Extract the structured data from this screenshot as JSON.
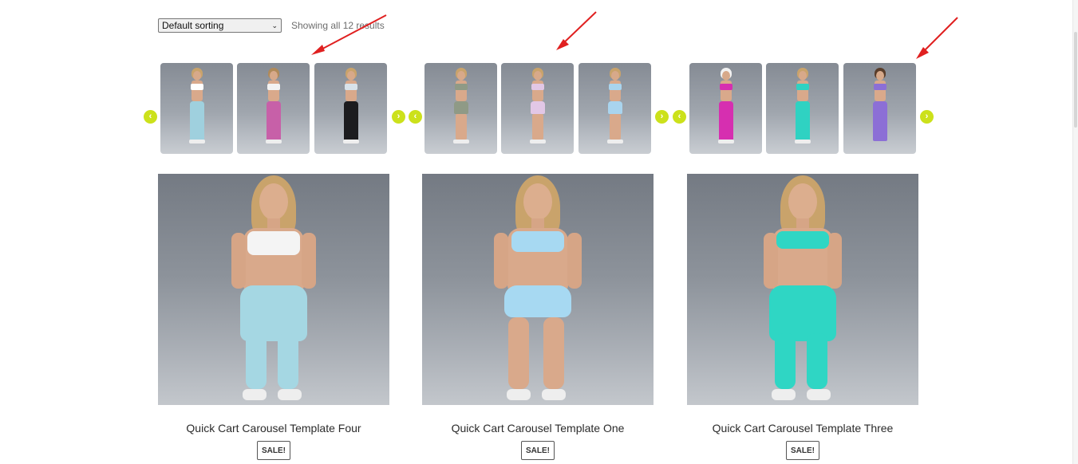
{
  "toolbar": {
    "sort_label": "Default sorting",
    "sort_options": [
      "Default sorting"
    ],
    "result_count": "Showing all 12 results"
  },
  "carousels": [
    {
      "thumbnails": [
        {
          "icon": "product-photo-light-blue-leggings"
        },
        {
          "icon": "product-photo-pink-leggings"
        },
        {
          "icon": "product-photo-black-leggings"
        }
      ],
      "prev_icon": "chevron-left-icon",
      "next_icon": "chevron-right-icon"
    },
    {
      "thumbnails": [
        {
          "icon": "product-photo-sage-shorts"
        },
        {
          "icon": "product-photo-lilac-shorts"
        },
        {
          "icon": "product-photo-sky-blue-shorts"
        }
      ],
      "prev_icon": "chevron-left-icon",
      "next_icon": "chevron-right-icon"
    },
    {
      "thumbnails": [
        {
          "icon": "product-photo-magenta-leggings"
        },
        {
          "icon": "product-photo-teal-leggings"
        },
        {
          "icon": "product-photo-purple-set"
        }
      ],
      "prev_icon": "chevron-left-icon",
      "next_icon": "chevron-right-icon"
    }
  ],
  "products": [
    {
      "title": "Quick Cart Carousel Template Four",
      "badge": "SALE!"
    },
    {
      "title": "Quick Cart Carousel Template One",
      "badge": "SALE!"
    },
    {
      "title": "Quick Cart Carousel Template Three",
      "badge": "SALE!"
    }
  ],
  "colors": {
    "nav_button": "#cce11b",
    "annotation_arrow": "#e02020"
  }
}
